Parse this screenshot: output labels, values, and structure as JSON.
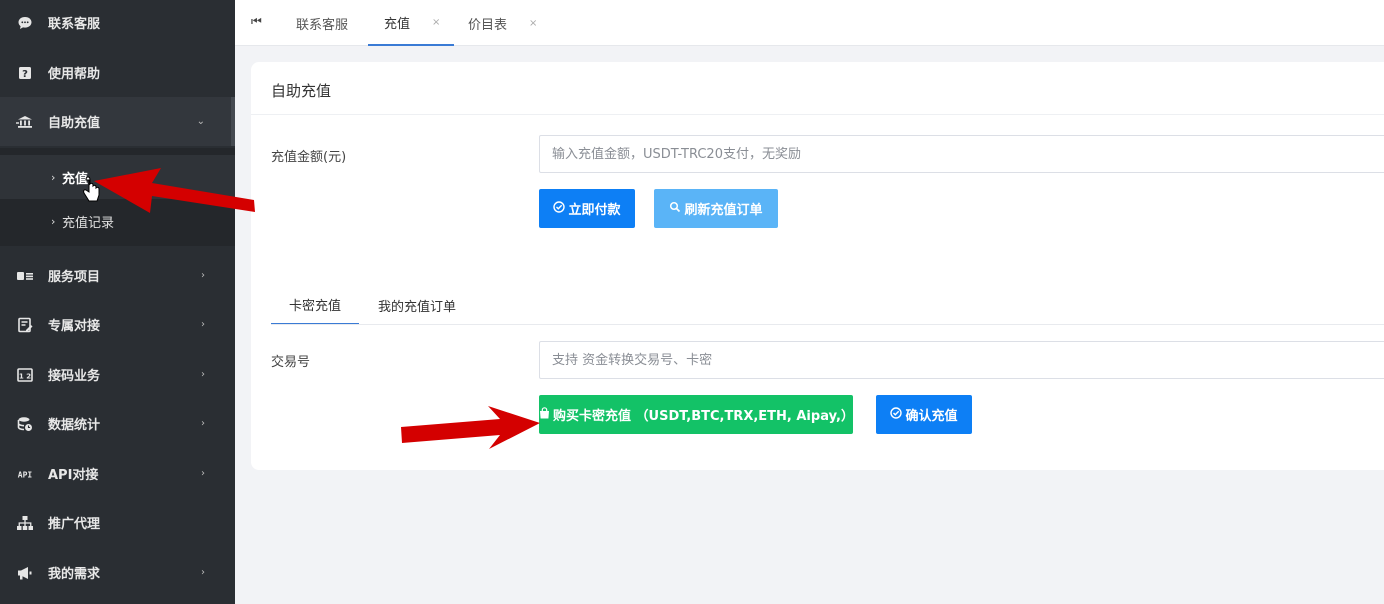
{
  "sidebar": {
    "items": [
      {
        "label": "联系客服",
        "icon": "chat-icon"
      },
      {
        "label": "使用帮助",
        "icon": "help-icon"
      },
      {
        "label": "自助充值",
        "icon": "bank-icon"
      },
      {
        "label": "服务项目",
        "icon": "card-list-icon"
      },
      {
        "label": "专属对接",
        "icon": "contract-icon"
      },
      {
        "label": "接码业务",
        "icon": "sms-code-icon"
      },
      {
        "label": "数据统计",
        "icon": "database-icon"
      },
      {
        "label": "API对接",
        "icon": "api-icon"
      },
      {
        "label": "推广代理",
        "icon": "org-tree-icon"
      },
      {
        "label": "我的需求",
        "icon": "megaphone-icon"
      }
    ],
    "submenu": [
      {
        "label": "充值",
        "active": true
      },
      {
        "label": "充值记录",
        "active": false
      }
    ]
  },
  "tabs": [
    {
      "label": "联系客服",
      "closable": false
    },
    {
      "label": "充值",
      "closable": true,
      "active": true
    },
    {
      "label": "价目表",
      "closable": true
    }
  ],
  "tab_close_glyph": "×",
  "card": {
    "title": "自助充值",
    "amount_label": "充值金额(元)",
    "amount_placeholder": "输入充值金额，USDT-TRC20支付，无奖励",
    "pay_button": "立即付款",
    "refresh_button": "刷新充值订单",
    "inner_tabs": [
      "卡密充值",
      "我的充值订单"
    ],
    "txn_label": "交易号",
    "txn_placeholder": "支持 资金转换交易号、卡密",
    "buy_button": "购买卡密充值 （USDT,BTC,TRX,ETH, Aipay,）",
    "confirm_button": "确认充值"
  },
  "colors": {
    "sidebar_bg": "#2a2e33",
    "primary": "#0d7ff5",
    "light_primary": "#5ab4f7",
    "success": "#13c267",
    "annotation_arrow": "#d40000"
  }
}
